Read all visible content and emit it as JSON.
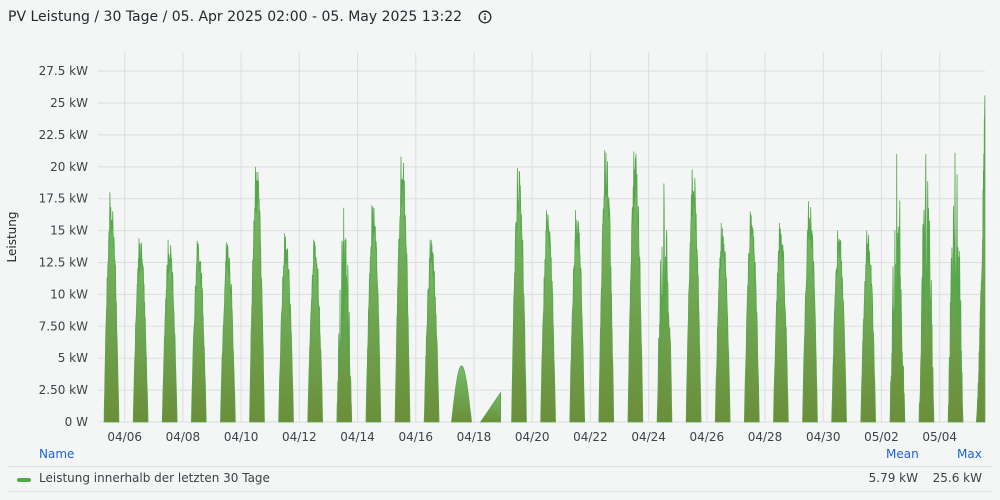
{
  "panel": {
    "title": "PV Leistung / 30 Tage / 05. Apr 2025 02:00 - 05. May 2025 13:22",
    "info_icon": "info-circle-icon"
  },
  "legend": {
    "name_header": "Name",
    "mean_header": "Mean",
    "max_header": "Max",
    "series_label": "Leistung innerhalb der letzten 30 Tage",
    "mean_value": "5.79 kW",
    "max_value": "25.6 kW"
  },
  "colors": {
    "series": "#56a64b",
    "fill_top": "#73bf69",
    "fill_bottom": "#6b8e3a",
    "legend_header": "#1f62e0"
  },
  "chart_data": {
    "type": "area",
    "title": "",
    "xlabel": "",
    "ylabel": "Leistung",
    "unit": "kW",
    "x_start": "2025-04-05 02:00",
    "x_end": "2025-05-05 13:22",
    "ylim": [
      0,
      29
    ],
    "y_ticks": [
      0,
      2.5,
      5,
      7.5,
      10,
      12.5,
      15,
      17.5,
      20,
      22.5,
      25,
      27.5
    ],
    "y_tick_labels": [
      "0 W",
      "2.50 kW",
      "5 kW",
      "7.50 kW",
      "10 kW",
      "12.5 kW",
      "15 kW",
      "17.5 kW",
      "20 kW",
      "22.5 kW",
      "25 kW",
      "27.5 kW"
    ],
    "x_ticks": [
      "2025-04-06",
      "2025-04-08",
      "2025-04-10",
      "2025-04-12",
      "2025-04-14",
      "2025-04-16",
      "2025-04-18",
      "2025-04-20",
      "2025-04-22",
      "2025-04-24",
      "2025-04-26",
      "2025-04-28",
      "2025-04-30",
      "2025-05-02",
      "2025-05-04"
    ],
    "x_tick_labels": [
      "04/06",
      "04/08",
      "04/10",
      "04/12",
      "04/14",
      "04/16",
      "04/18",
      "04/20",
      "04/22",
      "04/24",
      "04/26",
      "04/28",
      "04/30",
      "05/02",
      "05/04"
    ],
    "grid": true,
    "legend": "bottom",
    "series": [
      {
        "name": "Leistung innerhalb der letzten 30 Tage",
        "daily": [
          {
            "date": "2025-04-05",
            "shape": "full",
            "peak": 18.0
          },
          {
            "date": "2025-04-06",
            "shape": "full",
            "peak": 14.4
          },
          {
            "date": "2025-04-07",
            "shape": "full",
            "peak": 14.3
          },
          {
            "date": "2025-04-08",
            "shape": "full",
            "peak": 14.2
          },
          {
            "date": "2025-04-09",
            "shape": "full",
            "peak": 14.1
          },
          {
            "date": "2025-04-10",
            "shape": "full",
            "peak": 20.0
          },
          {
            "date": "2025-04-11",
            "shape": "full",
            "peak": 14.8
          },
          {
            "date": "2025-04-12",
            "shape": "full",
            "peak": 14.3
          },
          {
            "date": "2025-04-13",
            "shape": "spiky",
            "peak": 16.8
          },
          {
            "date": "2025-04-14",
            "shape": "full",
            "peak": 17.0
          },
          {
            "date": "2025-04-15",
            "shape": "full",
            "peak": 20.8
          },
          {
            "date": "2025-04-16",
            "shape": "full",
            "peak": 14.3
          },
          {
            "date": "2025-04-17",
            "shape": "low",
            "peak": 4.4
          },
          {
            "date": "2025-04-18",
            "shape": "low",
            "peak": 2.3
          },
          {
            "date": "2025-04-19",
            "shape": "full",
            "peak": 19.9
          },
          {
            "date": "2025-04-20",
            "shape": "full",
            "peak": 16.6
          },
          {
            "date": "2025-04-21",
            "shape": "full",
            "peak": 16.6
          },
          {
            "date": "2025-04-22",
            "shape": "full",
            "peak": 21.3
          },
          {
            "date": "2025-04-23",
            "shape": "full",
            "peak": 21.2
          },
          {
            "date": "2025-04-24",
            "shape": "spiky",
            "peak": 18.7
          },
          {
            "date": "2025-04-25",
            "shape": "full",
            "peak": 19.8
          },
          {
            "date": "2025-04-26",
            "shape": "full",
            "peak": 15.6
          },
          {
            "date": "2025-04-27",
            "shape": "full",
            "peak": 16.5
          },
          {
            "date": "2025-04-28",
            "shape": "full",
            "peak": 15.6
          },
          {
            "date": "2025-04-29",
            "shape": "full",
            "peak": 17.3
          },
          {
            "date": "2025-04-30",
            "shape": "full",
            "peak": 15.0
          },
          {
            "date": "2025-05-01",
            "shape": "full",
            "peak": 15.0
          },
          {
            "date": "2025-05-02",
            "shape": "spiky",
            "peak": 21.0
          },
          {
            "date": "2025-05-03",
            "shape": "spiky",
            "peak": 21.0
          },
          {
            "date": "2025-05-04",
            "shape": "spiky",
            "peak": 21.1
          },
          {
            "date": "2025-05-05",
            "shape": "rising",
            "peak": 25.6
          }
        ]
      }
    ]
  }
}
